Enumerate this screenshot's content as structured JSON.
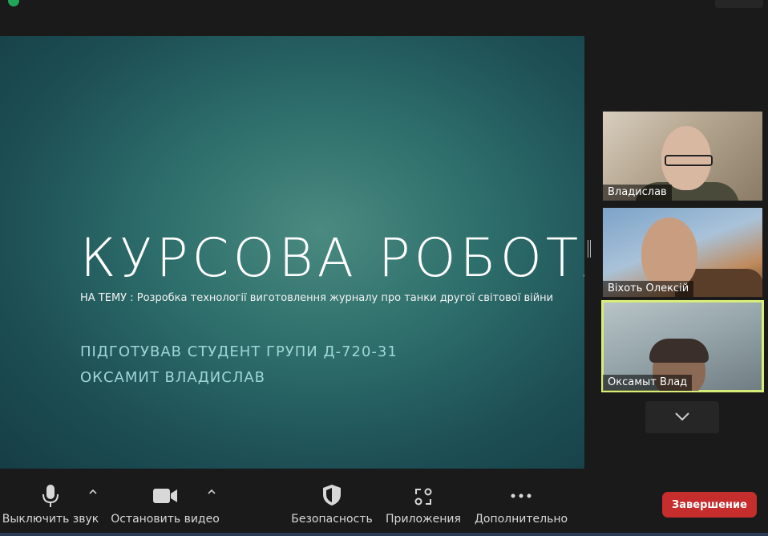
{
  "slide": {
    "title": "КУРСОВА РОБОТА",
    "topic": "НА ТЕМУ : Розробка технології виготовлення журналу про танки другої світової війни",
    "prepared_by": "ПІДГОТУВАВ СТУДЕНТ ГРУПИ Д-720-31",
    "author": "ОКСАМИТ ВЛАДИСЛАВ"
  },
  "participants": [
    {
      "name": "Владислав"
    },
    {
      "name": "Віхоть Олексій"
    },
    {
      "name": "Оксамыт Влад",
      "active_speaker": true
    }
  ],
  "toolbar": {
    "mute_label": "Выключить звук",
    "video_label": "Остановить видео",
    "security_label": "Безопасность",
    "apps_label": "Приложения",
    "more_label": "Дополнительно",
    "end_label": "Завершение"
  },
  "icons": {
    "mute": "microphone-icon",
    "video": "video-camera-icon",
    "security": "shield-icon",
    "apps": "apps-icon",
    "more": "more-dots-icon",
    "scroll": "chevron-down-icon"
  },
  "colors": {
    "end_button": "#c62d2d",
    "active_speaker_border": "#d8ec7a",
    "slide_accent_text": "#9fd6d6"
  }
}
